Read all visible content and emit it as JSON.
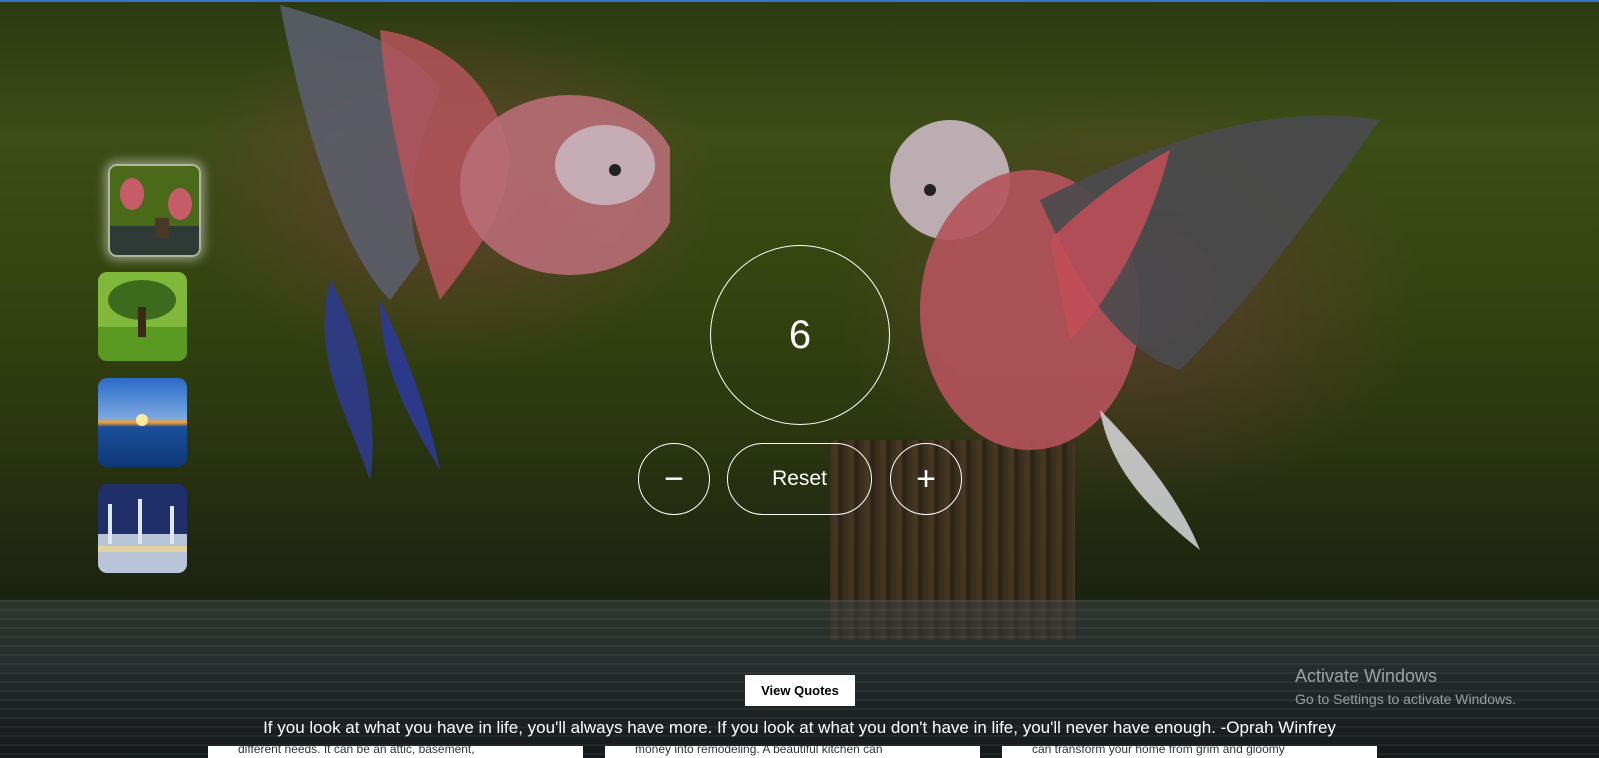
{
  "counter": {
    "value": "6",
    "decrement_label": "−",
    "reset_label": "Reset",
    "increment_label": "+"
  },
  "background_images": [
    {
      "name": "galah-cockatoos"
    },
    {
      "name": "tree-meadow"
    },
    {
      "name": "sunset-sea"
    },
    {
      "name": "mosque-night"
    }
  ],
  "quotes": {
    "button_label": "View Quotes",
    "text": "If you look at what you have in life, you'll always have more. If you look at what you don't have in life, you'll never have enough. -Oprah Winfrey"
  },
  "watermark": {
    "title": "Activate Windows",
    "subtitle": "Go to Settings to activate Windows."
  },
  "cards": [
    "different needs. It can be an attic, basement,",
    "money into remodeling. A beautiful kitchen can",
    "can transform your home from grim and gloomy"
  ],
  "colors": {
    "accent_line": "#3a74c9",
    "control_stroke": "#ffffff",
    "button_bg": "#ffffff"
  }
}
